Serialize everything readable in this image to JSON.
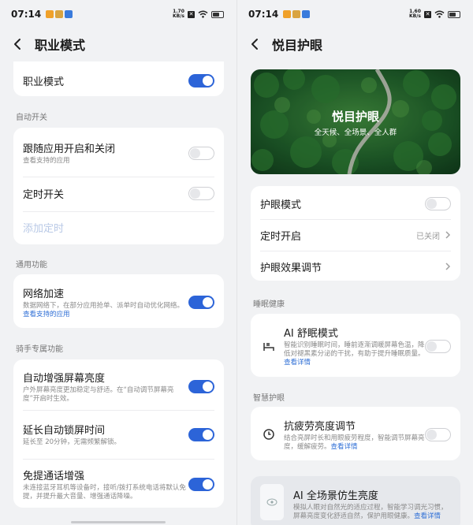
{
  "left": {
    "status": {
      "time": "07:14",
      "speed_top": "1.70",
      "speed_bottom": "KB/s"
    },
    "header": {
      "title": "职业模式"
    },
    "main_toggle": {
      "label": "职业模式",
      "on": true
    },
    "auto_switch": {
      "section": "自动开关",
      "follow_app": {
        "label": "跟随应用开启和关闭",
        "link": "查看支持的应用",
        "on": false
      },
      "timed": {
        "label": "定时开关",
        "on": false
      },
      "add_timer": "添加定时"
    },
    "general": {
      "section": "通用功能",
      "network": {
        "label": "网络加速",
        "desc": "数据网络下，在部分应用抢单、派单时自动优化网络。",
        "link": "查看支持的应用",
        "on": true
      }
    },
    "rider": {
      "section": "骑手专属功能",
      "brightness": {
        "label": "自动增强屏幕亮度",
        "desc": "户外屏幕亮度更加稳定与舒适。在“自动调节屏幕亮度”开启时生效。",
        "on": true
      },
      "lock": {
        "label": "延长自动锁屏时间",
        "desc": "延长至 20分钟，无需频繁解锁。",
        "on": true
      },
      "call": {
        "label": "免提通话增强",
        "desc": "未连接蓝牙耳机等设备时，接听/拨打系统电话将默认免提，并提升最大音量、增强通话降噪。",
        "on": true
      }
    }
  },
  "right": {
    "status": {
      "time": "07:14",
      "speed_top": "1.60",
      "speed_bottom": "KB/s"
    },
    "header": {
      "title": "悦目护眼"
    },
    "banner": {
      "title": "悦目护眼",
      "subtitle": "全天候、全场景、全人群"
    },
    "eye_mode": {
      "label": "护眼模式",
      "on": false
    },
    "schedule": {
      "label": "定时开启",
      "value": "已关闭"
    },
    "effect": {
      "label": "护眼效果调节"
    },
    "sleep": {
      "section": "睡眠健康",
      "ai_sleep": {
        "label": "AI 舒眠模式",
        "desc": "智能识别睡眠时间，睡前逐渐调暖屏幕色温，降低对褪黑素分泌的干扰，有助于提升睡眠质量。",
        "link": "查看详情",
        "on": false
      }
    },
    "smart": {
      "section": "智慧护眼",
      "anti_fatigue": {
        "label": "抗疲劳亮度调节",
        "desc": "结合亮屏时长和用眼疲劳程度，智能调节屏幕亮度，缓解疲劳。",
        "link": "查看详情",
        "on": false
      }
    },
    "ai_scene": {
      "label": "AI 全场景仿生亮度",
      "desc": "模拟人眼对自然光的适应过程，智能学习调光习惯，屏幕亮度变化舒适自然，保护用眼健康。",
      "link": "查看详情"
    }
  },
  "colors": {
    "accent": "#2c64d8",
    "link": "#2f6fd6",
    "background": "#f1f2f4"
  },
  "icons": [
    "back-arrow-icon",
    "chevron-right-icon",
    "bed-icon",
    "clock-icon",
    "wifi-icon",
    "battery-icon"
  ]
}
